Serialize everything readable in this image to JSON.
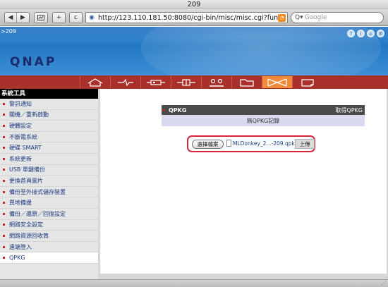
{
  "browser": {
    "window_title": "209",
    "url": "http://123.110.181.50:8080/cgi-bin/misc/misc.cgi?func=qpk",
    "search_placeholder": "Google",
    "buttons": {
      "back": "◀",
      "forward": "▶",
      "add": "+",
      "reload": "c"
    }
  },
  "header": {
    "model": ">209",
    "logo": "QNAP",
    "icons": [
      "help-icon",
      "info-icon",
      "home-icon",
      "settings-icon"
    ]
  },
  "nav": {
    "tabs": [
      {
        "name": "home-icon"
      },
      {
        "name": "network-icon"
      },
      {
        "name": "device-icon"
      },
      {
        "name": "user-icon"
      },
      {
        "name": "group-icon"
      },
      {
        "name": "folder-icon"
      },
      {
        "name": "system-tools-icon"
      },
      {
        "name": "status-icon"
      }
    ],
    "active_index": 6
  },
  "sidebar": {
    "title": "系統工具",
    "items": [
      {
        "label": "警訊通知"
      },
      {
        "label": "關機／重新啟動"
      },
      {
        "label": "硬體設定"
      },
      {
        "label": "不斷電系統"
      },
      {
        "label": "硬碟 SMART"
      },
      {
        "label": "系統更新"
      },
      {
        "label": "USB 單鍵備份"
      },
      {
        "label": "更換首頁圖片"
      },
      {
        "label": "備份至外接式儲存裝置"
      },
      {
        "label": "異地備援"
      },
      {
        "label": "備份／還原／回復設定"
      },
      {
        "label": "網路安全設定"
      },
      {
        "label": "網路資源回收筒"
      },
      {
        "label": "遠端登入"
      },
      {
        "label": "QPKG"
      }
    ],
    "active_index": 14
  },
  "qpkg": {
    "title": "QPKG",
    "get_link": "取得QPKG",
    "empty_text": "無QPKG記錄",
    "choose_file_label": "選擇檔案",
    "file_name": "MLDonkey_2...-209.qpkg",
    "upload_label": "上傳"
  },
  "colors": {
    "nav_bg": "#a9302b",
    "nav_active": "#f08a3a",
    "header_blue": "#2478c4",
    "highlight_border": "#d7263a"
  }
}
